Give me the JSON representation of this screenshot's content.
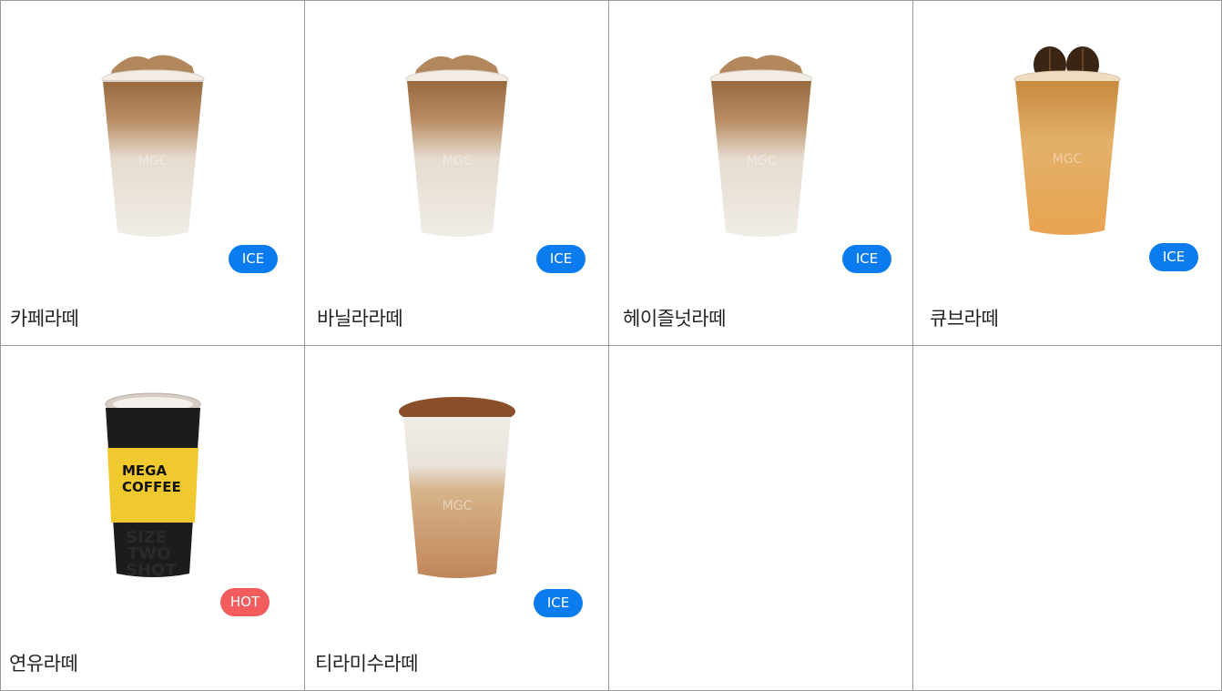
{
  "menu": [
    {
      "name": "카페라떼",
      "badge": "ICE",
      "badge_color": "#0a7cf0",
      "image": "iced-latte-cup-icon"
    },
    {
      "name": "바닐라라떼",
      "badge": "ICE",
      "badge_color": "#0a7cf0",
      "image": "iced-latte-cup-icon"
    },
    {
      "name": "헤이즐넛라떼",
      "badge": "ICE",
      "badge_color": "#0a7cf0",
      "image": "iced-latte-cup-icon"
    },
    {
      "name": "큐브라떼",
      "badge": "ICE",
      "badge_color": "#0a7cf0",
      "image": "cube-latte-cup-icon"
    },
    {
      "name": "연유라떼",
      "badge": "HOT",
      "badge_color": "#f25c5c",
      "image": "hot-coffee-cup-icon"
    },
    {
      "name": "티라미수라떼",
      "badge": "ICE",
      "badge_color": "#0a7cf0",
      "image": "tiramisu-latte-cup-icon"
    }
  ],
  "hot_cup_print": {
    "line1": "MEGA",
    "line2": "COFFEE",
    "line3": "SIZE",
    "line4": "TWO",
    "line5": "SHOT"
  }
}
